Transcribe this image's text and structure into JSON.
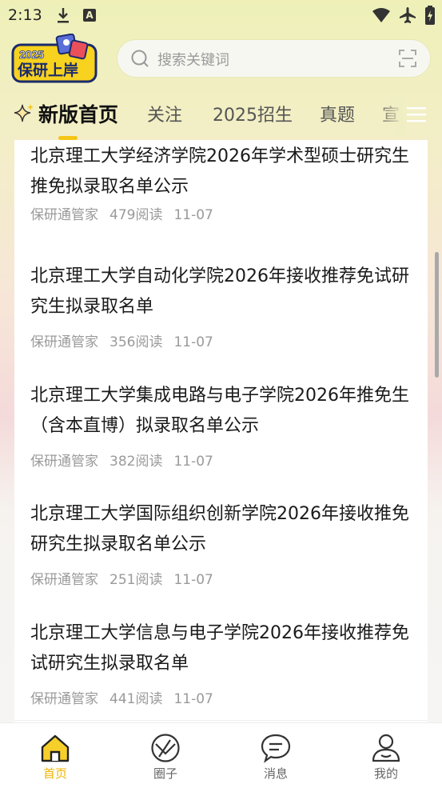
{
  "status": {
    "time": "2:13"
  },
  "logo": {
    "year": "2025",
    "text": "保研上岸"
  },
  "search": {
    "placeholder": "搜索关键词"
  },
  "tabs": [
    {
      "label": "新版首页",
      "active": true
    },
    {
      "label": "关注",
      "active": false
    },
    {
      "label": "2025招生",
      "active": false
    },
    {
      "label": "真题",
      "active": false
    },
    {
      "label": "宣",
      "active": false
    }
  ],
  "articles": [
    {
      "title": "北京理工大学经济学院2026年学术型硕士研究生推免拟录取名单公示",
      "author": "保研通管家",
      "reads": "479阅读",
      "date": "11-07"
    },
    {
      "title": "北京理工大学自动化学院2026年接收推荐免试研究生拟录取名单",
      "author": "保研通管家",
      "reads": "356阅读",
      "date": "11-07"
    },
    {
      "title": "北京理工大学集成电路与电子学院2026年推免生（含本直博）拟录取名单公示",
      "author": "保研通管家",
      "reads": "382阅读",
      "date": "11-07"
    },
    {
      "title": "北京理工大学国际组织创新学院2026年接收推免研究生拟录取名单公示",
      "author": "保研通管家",
      "reads": "251阅读",
      "date": "11-07"
    },
    {
      "title": "北京理工大学信息与电子学院2026年接收推荐免试研究生拟录取名单",
      "author": "保研通管家",
      "reads": "441阅读",
      "date": "11-07"
    }
  ],
  "bottom_nav": [
    {
      "label": "首页",
      "icon": "home-icon",
      "active": true
    },
    {
      "label": "圈子",
      "icon": "circle-icon",
      "active": false
    },
    {
      "label": "消息",
      "icon": "message-icon",
      "active": false
    },
    {
      "label": "我的",
      "icon": "user-icon",
      "active": false
    }
  ],
  "colors": {
    "accent": "#f5c518",
    "active_nav": "#f0b400"
  }
}
